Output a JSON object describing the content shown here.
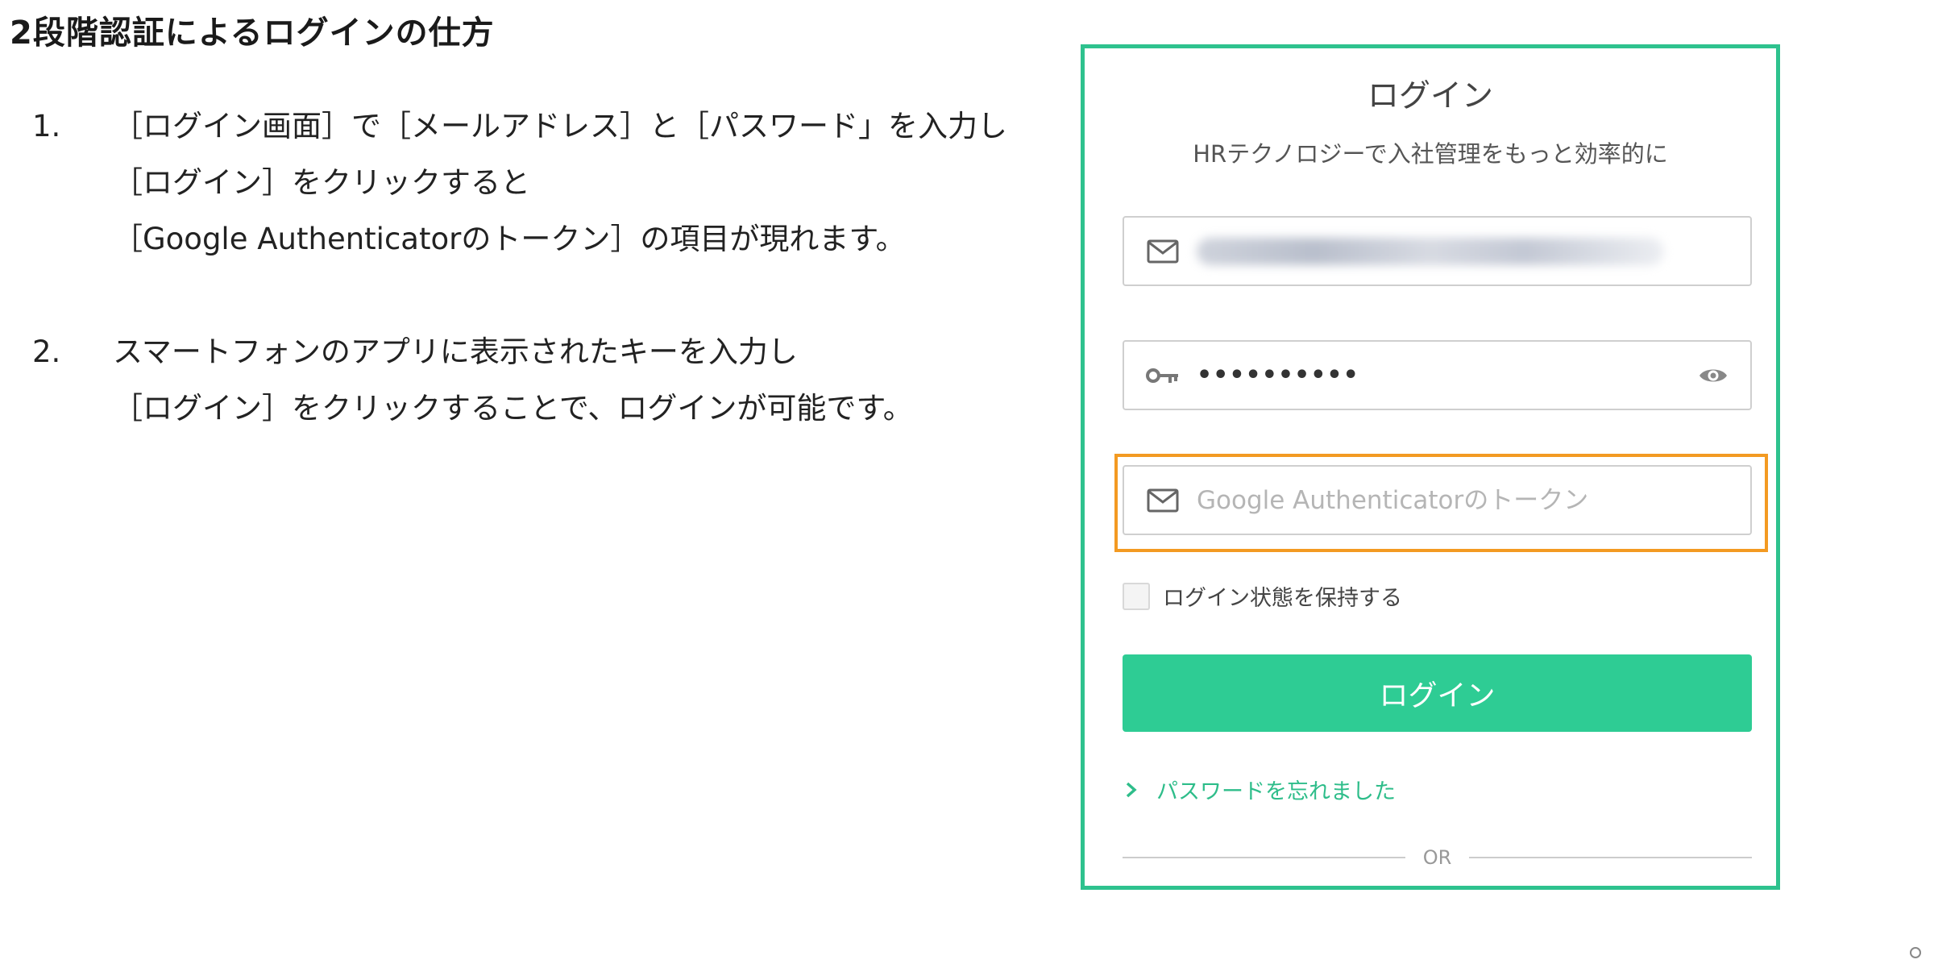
{
  "page": {
    "title": "2段階認証によるログインの仕方"
  },
  "steps": [
    {
      "number": "1.",
      "lines": [
        "［ログイン画面］で［メールアドレス］と［パスワード」を入力し",
        "［ログイン］をクリックすると",
        "［Google Authenticatorのトークン］の項目が現れます。"
      ]
    },
    {
      "number": "2.",
      "lines": [
        "スマートフォンのアプリに表示されたキーを入力し",
        "［ログイン］をクリックすることで、ログインが可能です。"
      ]
    }
  ],
  "login": {
    "title": "ログイン",
    "subtitle": "HRテクノロジーで入社管理をもっと効率的に",
    "password_value": "••••••••••",
    "token_placeholder": "Google Authenticatorのトークン",
    "remember_label": "ログイン状態を保持する",
    "remember_checked": false,
    "login_button": "ログイン",
    "forgot_password": "パスワードを忘れました",
    "or_text": "OR"
  },
  "icons": {
    "email": "mail-icon",
    "password": "key-icon",
    "show_password": "eye-icon",
    "token": "mail-icon",
    "forgot": "chevron-right-icon"
  },
  "colors": {
    "panel_border": "#2ec28e",
    "button": "#2ecc94",
    "highlight": "#f39a22",
    "link": "#2ebd8a"
  }
}
